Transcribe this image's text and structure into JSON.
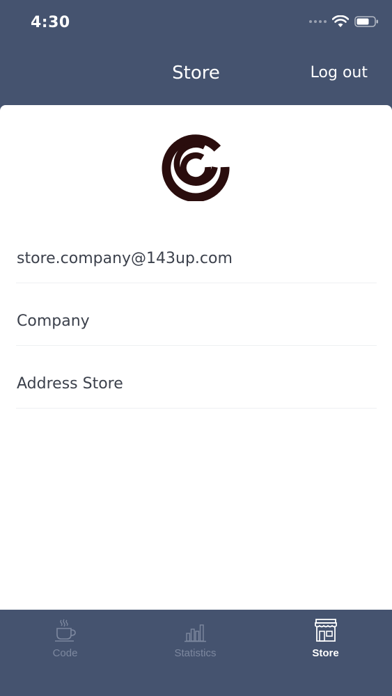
{
  "status_bar": {
    "time": "4:30"
  },
  "nav": {
    "title": "Store",
    "logout_label": "Log out"
  },
  "logo": {
    "icon": "spiral-c-logo",
    "color": "#2a0d0d"
  },
  "fields": {
    "email": "store.company@143up.com",
    "company": "Company",
    "address": "Address Store"
  },
  "tabs": [
    {
      "label": "Code",
      "icon": "coffee-cup-icon",
      "active": false
    },
    {
      "label": "Statistics",
      "icon": "bar-chart-icon",
      "active": false
    },
    {
      "label": "Store",
      "icon": "storefront-icon",
      "active": true
    }
  ],
  "colors": {
    "header_bg": "#45536f",
    "tab_inactive": "#7d889f",
    "tab_active": "#ffffff"
  }
}
